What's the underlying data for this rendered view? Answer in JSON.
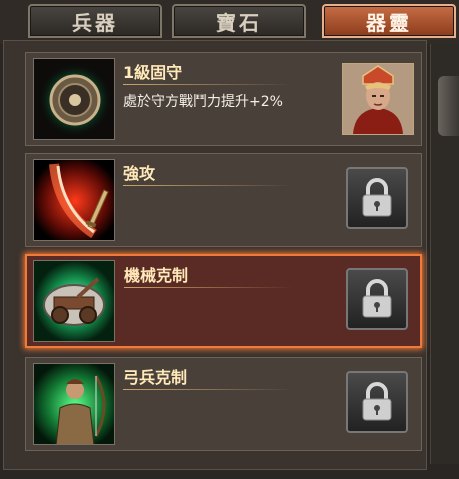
{
  "tabs": [
    {
      "label": "兵器",
      "active": false
    },
    {
      "label": "寶石",
      "active": false
    },
    {
      "label": "器靈",
      "active": true
    }
  ],
  "skills": [
    {
      "title": "1級固守",
      "description": "處於守方戰鬥力提升+2%",
      "icon": "shield-icon",
      "locked": false,
      "has_portrait": true,
      "selected": false
    },
    {
      "title": "強攻",
      "description": "",
      "icon": "blade-slash-icon",
      "locked": true,
      "selected": false
    },
    {
      "title": "機械克制",
      "description": "",
      "icon": "siege-machine-icon",
      "locked": true,
      "selected": true
    },
    {
      "title": "弓兵克制",
      "description": "",
      "icon": "archer-icon",
      "locked": true,
      "selected": false
    }
  ],
  "colors": {
    "accent": "#f07a3a",
    "title_text": "#ffe9b8",
    "tab_active": "#b2552e"
  }
}
